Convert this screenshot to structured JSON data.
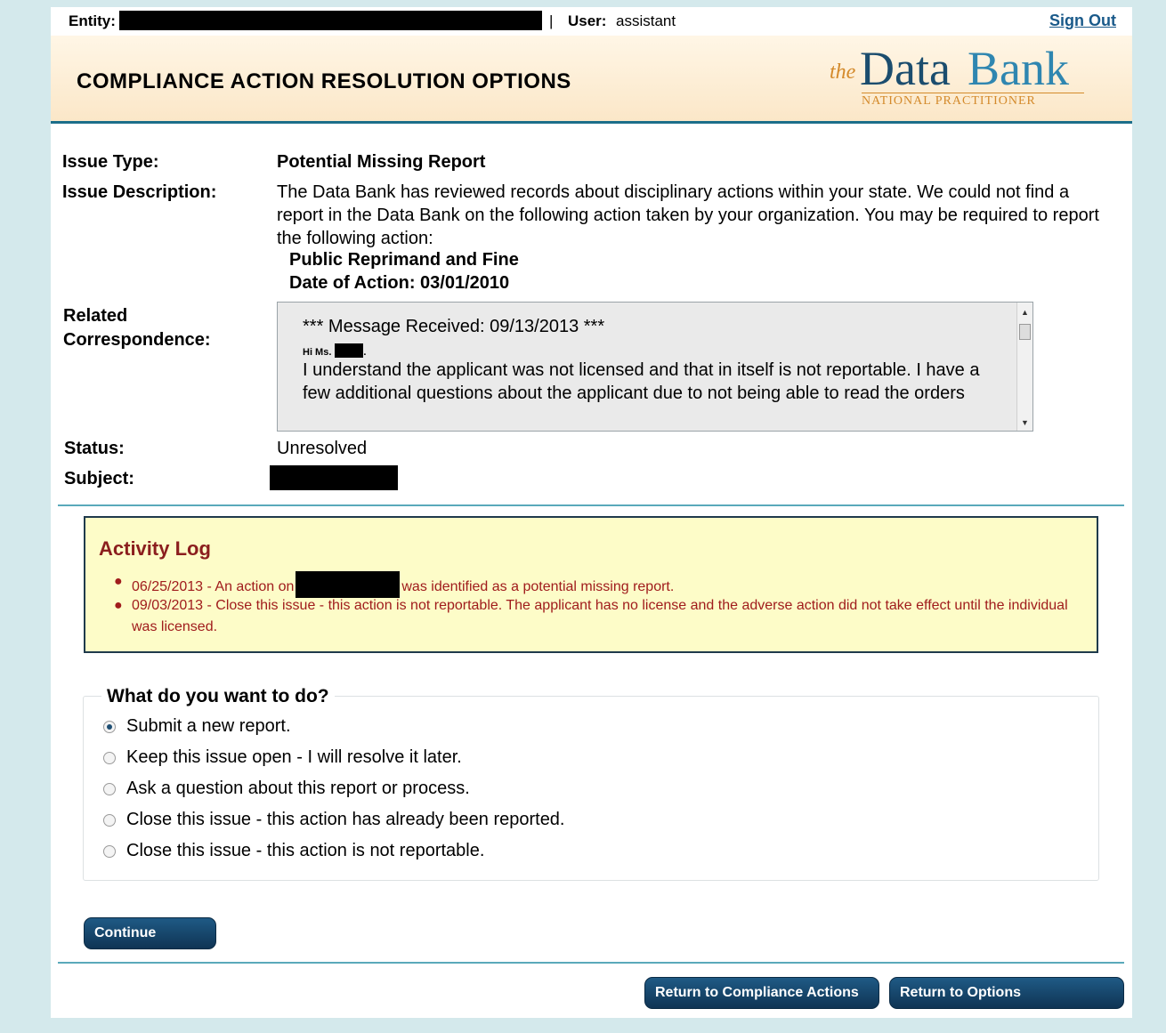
{
  "topbar": {
    "entity_label": "Entity:",
    "separator": "|",
    "user_label": "User:",
    "user_name": "assistant",
    "sign_out": "Sign Out"
  },
  "header": {
    "title": "COMPLIANCE ACTION RESOLUTION OPTIONS",
    "logo": {
      "the": "the",
      "data": "Data",
      "bank": "Bank",
      "subtitle": "NATIONAL PRACTITIONER"
    }
  },
  "details": {
    "issue_type_label": "Issue Type:",
    "issue_type_value": "Potential Missing Report",
    "issue_desc_label": "Issue Description:",
    "issue_desc_text": "The Data Bank has reviewed records about disciplinary actions within your state. We could not find a report in the Data Bank on the following action taken by your organization. You may be required to report the following action:",
    "action_name": "Public Reprimand and Fine",
    "action_date": "Date of Action: 03/01/2010",
    "related_label_1": "Related",
    "related_label_2": "Correspondence:",
    "status_label": "Status:",
    "status_value": "Unresolved",
    "subject_label": "Subject:"
  },
  "correspondence": {
    "header": "*** Message Received: 09/13/2013 ***",
    "greeting": "Hi Ms.",
    "greeting_end": ".",
    "body": "I understand the applicant was not licensed and that in itself is not reportable. I have a few additional questions about the applicant due to not being able to read the orders"
  },
  "activity_log": {
    "title": "Activity Log",
    "entry1_pre": "06/25/2013 - An action on",
    "entry1_post": "was identified as a potential missing report.",
    "entry2": "09/03/2013 - Close this issue - this action is not reportable. The applicant has no license and the adverse action did not take effect until the individual was licensed."
  },
  "options": {
    "legend": "What do you want to do?",
    "items": [
      {
        "label": "Submit a new report.",
        "checked": true
      },
      {
        "label": "Keep this issue open - I will resolve it later.",
        "checked": false
      },
      {
        "label": "Ask a question about this report or process.",
        "checked": false
      },
      {
        "label": "Close this issue - this action has already been reported.",
        "checked": false
      },
      {
        "label": "Close this issue - this action is not reportable.",
        "checked": false
      }
    ]
  },
  "buttons": {
    "continue": "Continue",
    "return_compliance": "Return to Compliance Actions",
    "return_options": "Return to Options"
  }
}
